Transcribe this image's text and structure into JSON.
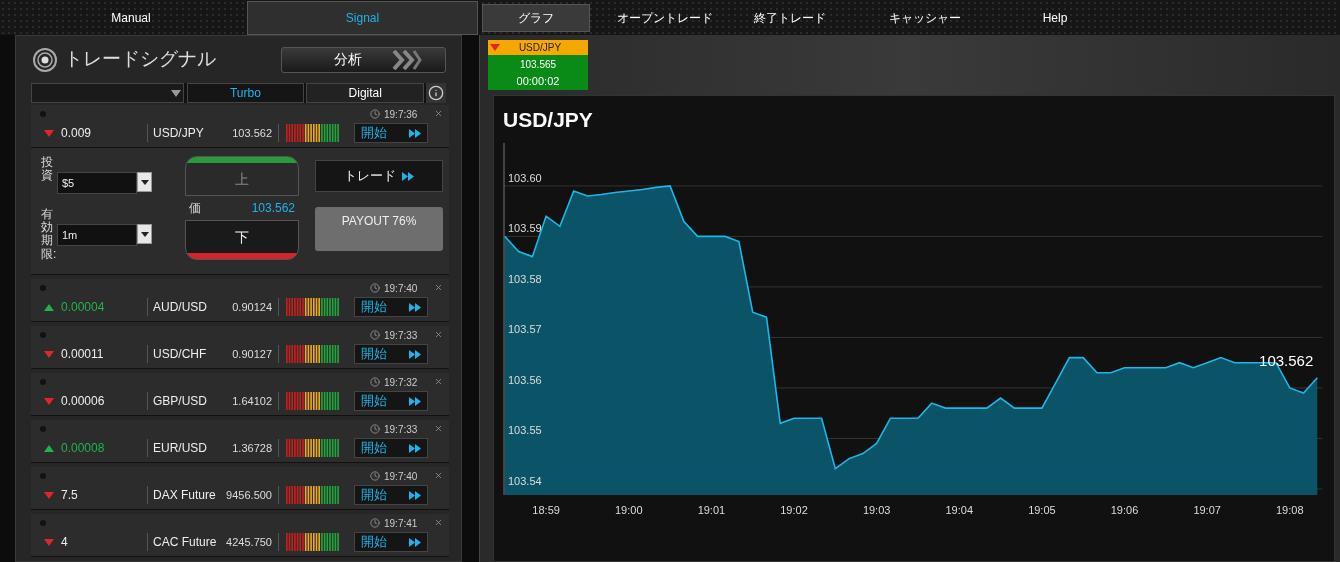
{
  "left_tabs": [
    {
      "label": "Manual",
      "selected": false
    },
    {
      "label": "Signal",
      "selected": true
    }
  ],
  "right_tabs": [
    {
      "label": "グラフ",
      "selected": true
    },
    {
      "label": "オープントレード",
      "selected": false
    },
    {
      "label": "終了トレード",
      "selected": false
    },
    {
      "label": "キャッシャー",
      "selected": false
    },
    {
      "label": "Help",
      "selected": false
    }
  ],
  "signals_panel": {
    "title": "トレードシグナル",
    "analysis_button": "分析",
    "filter": {
      "types": [
        {
          "label": "Turbo",
          "selected": true
        },
        {
          "label": "Digital",
          "selected": false
        }
      ]
    },
    "rows": [
      {
        "rising": false,
        "change": "0.009",
        "asset": "USD/JPY",
        "price": "103.562",
        "time": "19:7:36",
        "button": "開始",
        "expanded": true
      },
      {
        "rising": true,
        "change": "0.00004",
        "asset": "AUD/USD",
        "price": "0.90124",
        "time": "19:7:40",
        "button": "開始",
        "expanded": false
      },
      {
        "rising": false,
        "change": "0.00011",
        "asset": "USD/CHF",
        "price": "0.90127",
        "time": "19:7:33",
        "button": "開始",
        "expanded": false
      },
      {
        "rising": false,
        "change": "0.00006",
        "asset": "GBP/USD",
        "price": "1.64102",
        "time": "19:7:32",
        "button": "開始",
        "expanded": false
      },
      {
        "rising": true,
        "change": "0.00008",
        "asset": "EUR/USD",
        "price": "1.36728",
        "time": "19:7:33",
        "button": "開始",
        "expanded": false
      },
      {
        "rising": false,
        "change": "7.5",
        "asset": "DAX Future",
        "price": "9456.500",
        "time": "19:7:40",
        "button": "開始",
        "expanded": false
      },
      {
        "rising": false,
        "change": "4",
        "asset": "CAC Future",
        "price": "4245.750",
        "time": "19:7:41",
        "button": "開始",
        "expanded": false
      }
    ],
    "trade_form": {
      "investment_label": "投資",
      "investment_value": "$5",
      "expiry_label": "有効期限:",
      "expiry_value": "1m",
      "up_button": "上",
      "down_button": "下",
      "price_label": "価",
      "price": "103.562",
      "trade_button": "トレード",
      "payout": "PAYOUT 76%"
    }
  },
  "ticker": {
    "rising": false,
    "asset": "USD/JPY",
    "price": "103.565",
    "countdown": "00:00:02"
  },
  "chart": {
    "chart_data": {
      "type": "area",
      "title": "USD/JPY",
      "categories": [
        null,
        null,
        null,
        "18:59",
        null,
        null,
        null,
        null,
        null,
        "19:00",
        null,
        null,
        null,
        null,
        null,
        "19:01",
        null,
        null,
        null,
        null,
        null,
        "19:02",
        null,
        null,
        null,
        null,
        null,
        "19:03",
        null,
        null,
        null,
        null,
        null,
        "19:04",
        null,
        null,
        null,
        null,
        null,
        "19:05",
        null,
        null,
        null,
        null,
        null,
        "19:06",
        null,
        null,
        null,
        null,
        null,
        "19:07",
        null,
        null,
        null,
        null,
        null,
        "19:08",
        null,
        null
      ],
      "series": [
        {
          "color": "#1ab8e6",
          "values": [
            103.59,
            103.587,
            103.586,
            103.594,
            103.592,
            103.599,
            103.598,
            103.5983,
            103.5987,
            103.599,
            103.5993,
            103.5997,
            103.6,
            103.593,
            103.59,
            103.59,
            103.59,
            103.589,
            103.575,
            103.574,
            103.553,
            103.554,
            103.554,
            103.554,
            103.544,
            103.546,
            103.547,
            103.549,
            103.554,
            103.554,
            103.554,
            103.557,
            103.556,
            103.556,
            103.556,
            103.556,
            103.558,
            103.556,
            103.556,
            103.556,
            103.561,
            103.566,
            103.566,
            103.563,
            103.563,
            103.564,
            103.564,
            103.564,
            103.564,
            103.565,
            103.564,
            103.565,
            103.566,
            103.565,
            103.565,
            103.565,
            103.565,
            103.56,
            103.559,
            103.562
          ]
        }
      ],
      "ylim": [
        103.5388,
        103.6085
      ],
      "grid": true,
      "yticks": [
        {
          "value": 103.54,
          "label": "103.54"
        },
        {
          "value": 103.55,
          "label": "103.55"
        },
        {
          "value": 103.56,
          "label": "103.56"
        },
        {
          "value": 103.57,
          "label": "103.57"
        },
        {
          "value": 103.58,
          "label": "103.58"
        },
        {
          "value": 103.59,
          "label": "103.59"
        },
        {
          "value": 103.6,
          "label": "103.60"
        }
      ],
      "annotations": [
        {
          "text": "103.562",
          "y": 103.562
        }
      ]
    }
  }
}
